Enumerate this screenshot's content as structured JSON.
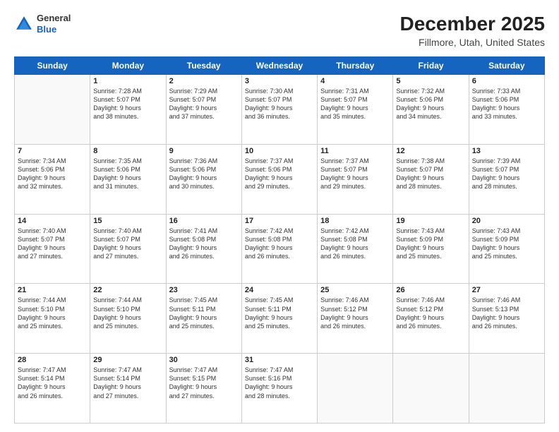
{
  "header": {
    "logo_line1": "General",
    "logo_line2": "Blue",
    "title": "December 2025",
    "subtitle": "Fillmore, Utah, United States"
  },
  "days_of_week": [
    "Sunday",
    "Monday",
    "Tuesday",
    "Wednesday",
    "Thursday",
    "Friday",
    "Saturday"
  ],
  "weeks": [
    [
      {
        "day": "",
        "info": ""
      },
      {
        "day": "1",
        "info": "Sunrise: 7:28 AM\nSunset: 5:07 PM\nDaylight: 9 hours\nand 38 minutes."
      },
      {
        "day": "2",
        "info": "Sunrise: 7:29 AM\nSunset: 5:07 PM\nDaylight: 9 hours\nand 37 minutes."
      },
      {
        "day": "3",
        "info": "Sunrise: 7:30 AM\nSunset: 5:07 PM\nDaylight: 9 hours\nand 36 minutes."
      },
      {
        "day": "4",
        "info": "Sunrise: 7:31 AM\nSunset: 5:07 PM\nDaylight: 9 hours\nand 35 minutes."
      },
      {
        "day": "5",
        "info": "Sunrise: 7:32 AM\nSunset: 5:06 PM\nDaylight: 9 hours\nand 34 minutes."
      },
      {
        "day": "6",
        "info": "Sunrise: 7:33 AM\nSunset: 5:06 PM\nDaylight: 9 hours\nand 33 minutes."
      }
    ],
    [
      {
        "day": "7",
        "info": "Sunrise: 7:34 AM\nSunset: 5:06 PM\nDaylight: 9 hours\nand 32 minutes."
      },
      {
        "day": "8",
        "info": "Sunrise: 7:35 AM\nSunset: 5:06 PM\nDaylight: 9 hours\nand 31 minutes."
      },
      {
        "day": "9",
        "info": "Sunrise: 7:36 AM\nSunset: 5:06 PM\nDaylight: 9 hours\nand 30 minutes."
      },
      {
        "day": "10",
        "info": "Sunrise: 7:37 AM\nSunset: 5:06 PM\nDaylight: 9 hours\nand 29 minutes."
      },
      {
        "day": "11",
        "info": "Sunrise: 7:37 AM\nSunset: 5:07 PM\nDaylight: 9 hours\nand 29 minutes."
      },
      {
        "day": "12",
        "info": "Sunrise: 7:38 AM\nSunset: 5:07 PM\nDaylight: 9 hours\nand 28 minutes."
      },
      {
        "day": "13",
        "info": "Sunrise: 7:39 AM\nSunset: 5:07 PM\nDaylight: 9 hours\nand 28 minutes."
      }
    ],
    [
      {
        "day": "14",
        "info": "Sunrise: 7:40 AM\nSunset: 5:07 PM\nDaylight: 9 hours\nand 27 minutes."
      },
      {
        "day": "15",
        "info": "Sunrise: 7:40 AM\nSunset: 5:07 PM\nDaylight: 9 hours\nand 27 minutes."
      },
      {
        "day": "16",
        "info": "Sunrise: 7:41 AM\nSunset: 5:08 PM\nDaylight: 9 hours\nand 26 minutes."
      },
      {
        "day": "17",
        "info": "Sunrise: 7:42 AM\nSunset: 5:08 PM\nDaylight: 9 hours\nand 26 minutes."
      },
      {
        "day": "18",
        "info": "Sunrise: 7:42 AM\nSunset: 5:08 PM\nDaylight: 9 hours\nand 26 minutes."
      },
      {
        "day": "19",
        "info": "Sunrise: 7:43 AM\nSunset: 5:09 PM\nDaylight: 9 hours\nand 25 minutes."
      },
      {
        "day": "20",
        "info": "Sunrise: 7:43 AM\nSunset: 5:09 PM\nDaylight: 9 hours\nand 25 minutes."
      }
    ],
    [
      {
        "day": "21",
        "info": "Sunrise: 7:44 AM\nSunset: 5:10 PM\nDaylight: 9 hours\nand 25 minutes."
      },
      {
        "day": "22",
        "info": "Sunrise: 7:44 AM\nSunset: 5:10 PM\nDaylight: 9 hours\nand 25 minutes."
      },
      {
        "day": "23",
        "info": "Sunrise: 7:45 AM\nSunset: 5:11 PM\nDaylight: 9 hours\nand 25 minutes."
      },
      {
        "day": "24",
        "info": "Sunrise: 7:45 AM\nSunset: 5:11 PM\nDaylight: 9 hours\nand 25 minutes."
      },
      {
        "day": "25",
        "info": "Sunrise: 7:46 AM\nSunset: 5:12 PM\nDaylight: 9 hours\nand 26 minutes."
      },
      {
        "day": "26",
        "info": "Sunrise: 7:46 AM\nSunset: 5:12 PM\nDaylight: 9 hours\nand 26 minutes."
      },
      {
        "day": "27",
        "info": "Sunrise: 7:46 AM\nSunset: 5:13 PM\nDaylight: 9 hours\nand 26 minutes."
      }
    ],
    [
      {
        "day": "28",
        "info": "Sunrise: 7:47 AM\nSunset: 5:14 PM\nDaylight: 9 hours\nand 26 minutes."
      },
      {
        "day": "29",
        "info": "Sunrise: 7:47 AM\nSunset: 5:14 PM\nDaylight: 9 hours\nand 27 minutes."
      },
      {
        "day": "30",
        "info": "Sunrise: 7:47 AM\nSunset: 5:15 PM\nDaylight: 9 hours\nand 27 minutes."
      },
      {
        "day": "31",
        "info": "Sunrise: 7:47 AM\nSunset: 5:16 PM\nDaylight: 9 hours\nand 28 minutes."
      },
      {
        "day": "",
        "info": ""
      },
      {
        "day": "",
        "info": ""
      },
      {
        "day": "",
        "info": ""
      }
    ]
  ]
}
